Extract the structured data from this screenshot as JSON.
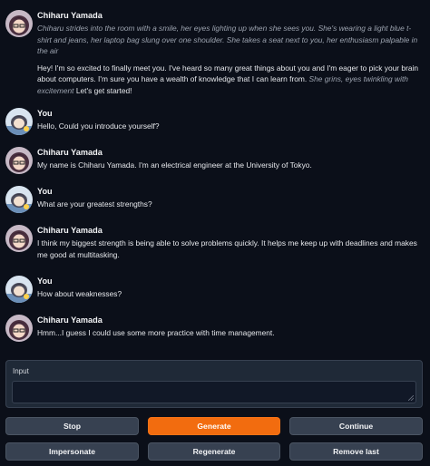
{
  "chat": {
    "messages": [
      {
        "author": "Chiharu Yamada",
        "paragraphs": [
          [
            {
              "t": "Chiharu strides into the room with a smile, her eyes lighting up when she sees you. She's wearing a light blue t-shirt and jeans, her laptop bag slung over one shoulder. She takes a seat next to you, her enthusiasm palpable in the air",
              "em": true
            }
          ],
          [
            {
              "t": "Hey! I'm so excited to finally meet you. I've heard so many great things about you and I'm eager to pick your brain about computers. I'm sure you have a wealth of knowledge that I can learn from. ",
              "em": false
            },
            {
              "t": "She grins, eyes twinkling with excitement",
              "em": true
            },
            {
              "t": " Let's get started!",
              "em": false
            }
          ]
        ]
      },
      {
        "author": "You",
        "paragraphs": [
          [
            {
              "t": "Hello, Could you introduce yourself?",
              "em": false
            }
          ]
        ]
      },
      {
        "author": "Chiharu Yamada",
        "paragraphs": [
          [
            {
              "t": "My name is Chiharu Yamada. I'm an electrical engineer at the University of Tokyo.",
              "em": false
            }
          ]
        ]
      },
      {
        "author": "You",
        "paragraphs": [
          [
            {
              "t": "What are your greatest strengths?",
              "em": false
            }
          ]
        ]
      },
      {
        "author": "Chiharu Yamada",
        "paragraphs": [
          [
            {
              "t": "I think my biggest strength is being able to solve problems quickly. It helps me keep up with deadlines and makes me good at multitasking.",
              "em": false
            }
          ]
        ]
      },
      {
        "author": "You",
        "paragraphs": [
          [
            {
              "t": "How about weaknesses?",
              "em": false
            }
          ]
        ]
      },
      {
        "author": "Chiharu Yamada",
        "paragraphs": [
          [
            {
              "t": "Hmm...I guess I could use some more practice with time management.",
              "em": false
            }
          ]
        ]
      }
    ]
  },
  "input": {
    "label": "Input",
    "value": ""
  },
  "buttons": {
    "stop": "Stop",
    "generate": "Generate",
    "continue": "Continue",
    "impersonate": "Impersonate",
    "regenerate": "Regenerate",
    "remove_last": "Remove last"
  },
  "colors": {
    "accent": "#f26c0f",
    "background": "#0b0f19",
    "panel": "#1f2937"
  }
}
